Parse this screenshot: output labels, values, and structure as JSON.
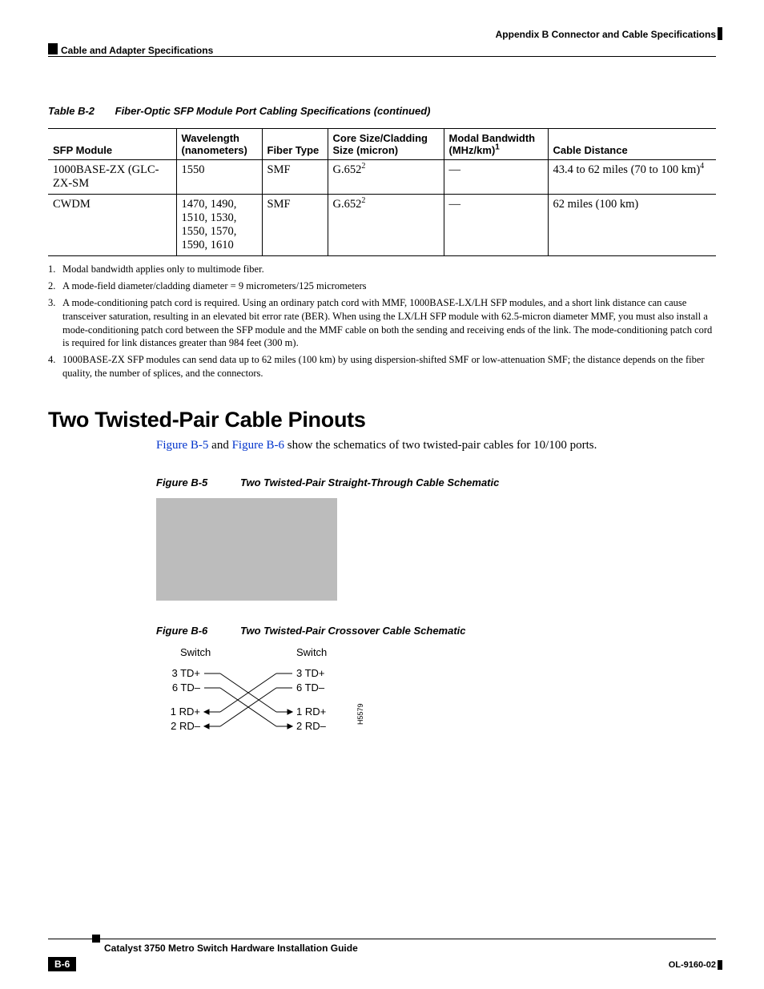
{
  "header": {
    "appendix_line": "Appendix B      Connector and Cable Specifications",
    "section_left": "Cable and Adapter Specifications"
  },
  "table_caption": {
    "num": "Table B-2",
    "title": "Fiber-Optic SFP Module Port Cabling Specifications (continued)"
  },
  "table": {
    "headers": {
      "c0": "SFP Module",
      "c1": "Wavelength (nanometers)",
      "c2": "Fiber Type",
      "c3": "Core Size/Cladding Size (micron)",
      "c4_a": "Modal Bandwidth (MHz/km)",
      "c4_sup": "1",
      "c5": "Cable Distance"
    },
    "rows": [
      {
        "c0": "1000BASE-ZX (GLC-ZX-SM",
        "c1": "1550",
        "c2": "SMF",
        "c3_a": "G.652",
        "c3_sup": "2",
        "c4": "—",
        "c5_a": "43.4 to 62 miles (70 to 100 km)",
        "c5_sup": "4"
      },
      {
        "c0": "CWDM",
        "c1": "1470, 1490, 1510, 1530, 1550, 1570, 1590, 1610",
        "c2": "SMF",
        "c3_a": "G.652",
        "c3_sup": "2",
        "c4": "—",
        "c5_a": "62 miles (100 km)",
        "c5_sup": ""
      }
    ]
  },
  "footnotes": [
    "Modal bandwidth applies only to multimode fiber.",
    "A mode-field diameter/cladding diameter = 9 micrometers/125 micrometers",
    "A mode-conditioning patch cord is required. Using an ordinary patch cord with MMF, 1000BASE-LX/LH SFP modules, and a short link distance can cause transceiver saturation, resulting in an elevated bit error rate (BER). When using the LX/LH SFP module with 62.5-micron diameter MMF, you must also install a mode-conditioning patch cord between the SFP module and the MMF cable on both the sending and receiving ends of the link. The mode-conditioning patch cord is required for link distances greater than 984 feet (300 m).",
    "1000BASE-ZX SFP modules can send data up to 62 miles (100 km) by using dispersion-shifted SMF or low-attenuation SMF; the distance depends on the fiber quality, the number of splices, and the connectors."
  ],
  "section_heading": "Two Twisted-Pair Cable Pinouts",
  "body_para": {
    "p1_a": "Figure B-5",
    "p1_b": " and ",
    "p1_c": "Figure B-6",
    "p1_d": " show the schematics of two twisted-pair cables for 10/100 ports."
  },
  "fig5": {
    "num": "Figure B-5",
    "title": "Two Twisted-Pair Straight-Through Cable Schematic"
  },
  "fig6": {
    "num": "Figure B-6",
    "title": "Two Twisted-Pair Crossover Cable Schematic",
    "left_header": "Switch",
    "right_header": "Switch",
    "labels": {
      "l1": "3 TD+",
      "l2": "6 TD–",
      "l3": "1 RD+",
      "l4": "2 RD–",
      "r1": "3 TD+",
      "r2": "6 TD–",
      "r3": "1 RD+",
      "r4": "2 RD–"
    },
    "id": "H5579"
  },
  "footer": {
    "title": "Catalyst 3750 Metro Switch Hardware Installation Guide",
    "page_num": "B-6",
    "doc_id": "OL-9160-02"
  },
  "chart_data": {
    "type": "table",
    "title": "Fiber-Optic SFP Module Port Cabling Specifications (continued)",
    "columns": [
      "SFP Module",
      "Wavelength (nanometers)",
      "Fiber Type",
      "Core Size/Cladding Size (micron)",
      "Modal Bandwidth (MHz/km)",
      "Cable Distance"
    ],
    "rows": [
      [
        "1000BASE-ZX (GLC-ZX-SM",
        "1550",
        "SMF",
        "G.652",
        "—",
        "43.4 to 62 miles (70 to 100 km)"
      ],
      [
        "CWDM",
        "1470, 1490, 1510, 1530, 1550, 1570, 1590, 1610",
        "SMF",
        "G.652",
        "—",
        "62 miles (100 km)"
      ]
    ]
  }
}
